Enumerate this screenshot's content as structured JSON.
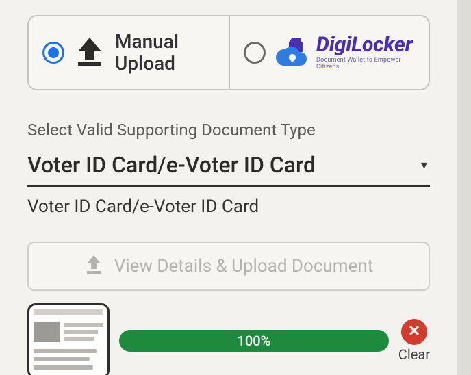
{
  "methods": {
    "manual": {
      "label": "Manual\nUpload",
      "checked": true
    },
    "digilocker": {
      "title": "DigiLocker",
      "tagline": "Document Wallet to Empower Citizens",
      "checked": false
    }
  },
  "docTypeSection": {
    "label": "Select Valid Supporting Document Type",
    "selected": "Voter ID Card/e-Voter ID Card",
    "echo": "Voter ID Card/e-Voter ID Card"
  },
  "viewDetails": {
    "label": "View Details & Upload Document"
  },
  "upload": {
    "progressText": "100%",
    "progressValue": 100,
    "clearLabel": "Clear"
  },
  "colors": {
    "accentBlue": "#1a73e8",
    "progressGreen": "#1e8a3e",
    "clearRed": "#d33b2e",
    "digiPurple": "#4b2fb3"
  }
}
